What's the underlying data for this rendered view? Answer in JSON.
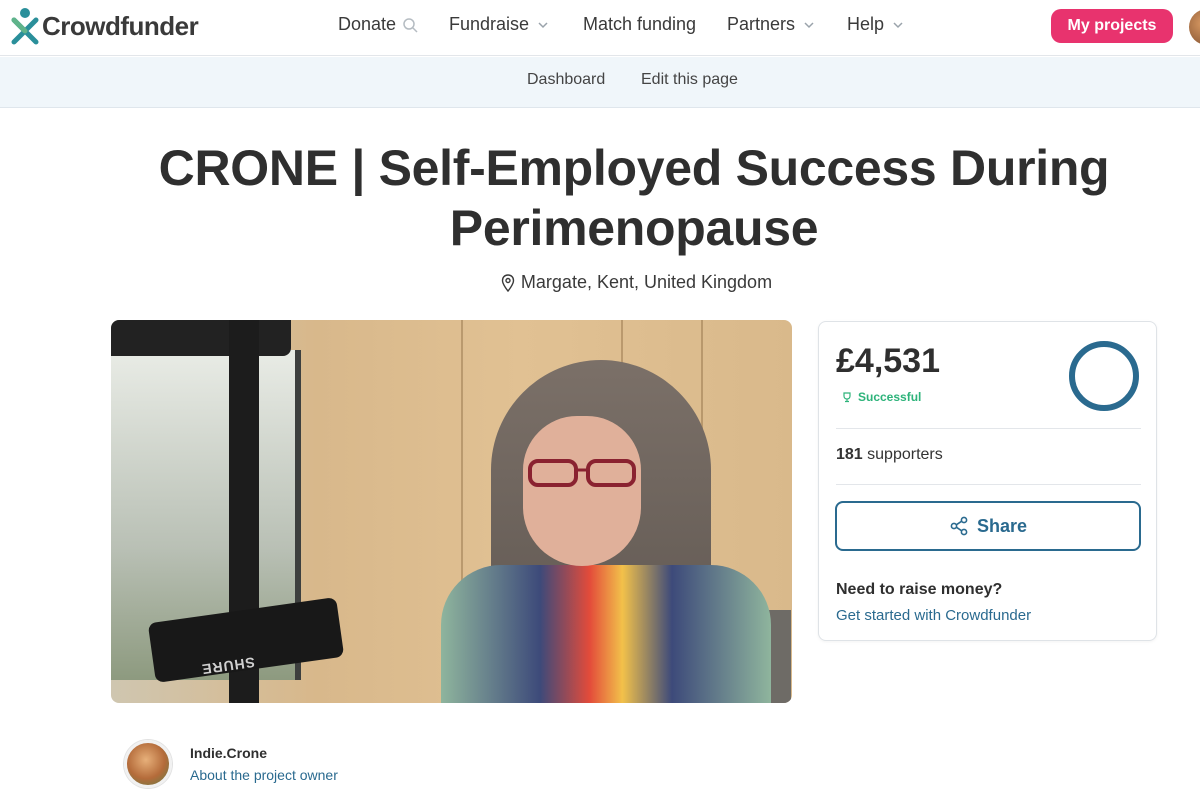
{
  "brand": {
    "name": "Crowdfunder",
    "accent": "#e8336e",
    "link": "#2a6a8f",
    "success": "#2db37a"
  },
  "topnav": {
    "items": [
      {
        "label": "Donate",
        "icon": "search-icon"
      },
      {
        "label": "Fundraise",
        "icon": "chevron-down-icon"
      },
      {
        "label": "Match funding"
      },
      {
        "label": "Partners",
        "icon": "chevron-down-icon"
      },
      {
        "label": "Help",
        "icon": "chevron-down-icon"
      }
    ],
    "cta": "My projects"
  },
  "subnav": {
    "items": [
      "Dashboard",
      "Edit this page"
    ]
  },
  "project": {
    "title": "CRONE | Self-Employed Success During Perimenopause",
    "location": "Margate, Kent, United Kingdom",
    "video_label": "SHURE"
  },
  "stats": {
    "amount": "£4,531",
    "status": "Successful",
    "supporters_count": "181",
    "supporters_label": "supporters",
    "share_label": "Share",
    "progress": 1.0,
    "raise_title": "Need to raise money?",
    "raise_link": "Get started with Crowdfunder"
  },
  "owner": {
    "name": "Indie.Crone",
    "link": "About the project owner"
  }
}
